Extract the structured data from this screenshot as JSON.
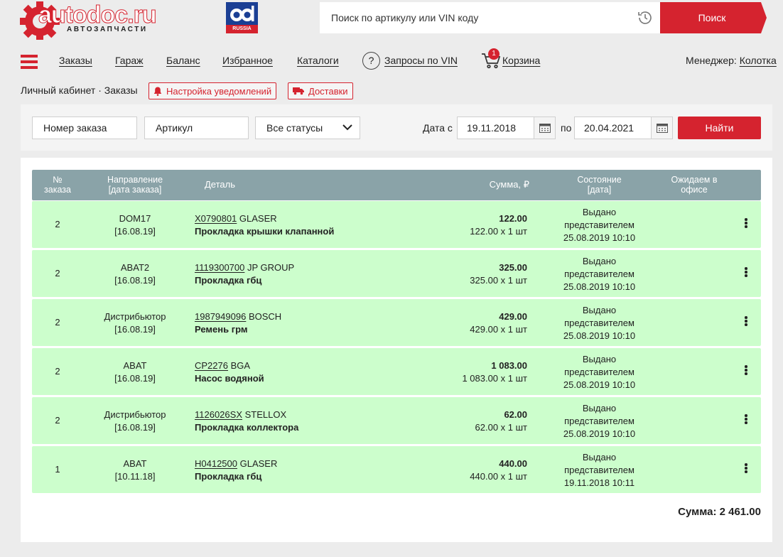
{
  "header": {
    "logo_main": "autodoc.ru",
    "logo_sub": "АВТОЗАПЧАСТИ",
    "partner_logo_text": "RUSSIA",
    "search_placeholder": "Поиск по артикулу или VIN коду",
    "search_button": "Поиск"
  },
  "nav": {
    "orders": "Заказы",
    "garage": "Гараж",
    "balance": "Баланс",
    "favorites": "Избранное",
    "catalogs": "Каталоги",
    "vin_icon": "?",
    "vin_requests": "Запросы по VIN",
    "cart_count": "1",
    "cart": "Корзина",
    "manager_label": "Менеджер:",
    "manager_name": "Колотка"
  },
  "breadcrumb": {
    "text": "Личный кабинет · Заказы",
    "notify_label": "Настройка уведомлений",
    "delivery_label": "Доставки"
  },
  "filters": {
    "order_number": "Номер заказа",
    "article": "Артикул",
    "status": "Все статусы",
    "date_from_label": "Дата с",
    "date_from": "19.11.2018",
    "date_to_label": "по",
    "date_to": "20.04.2021",
    "find_button": "Найти"
  },
  "table": {
    "headers": {
      "num_1": "№",
      "num_2": "заказа",
      "dir_1": "Направление",
      "dir_2": "[дата заказа]",
      "detail": "Деталь",
      "sum": "Сумма, ₽",
      "state_1": "Состояние",
      "state_2": "[дата]",
      "office_1": "Ожидаем в",
      "office_2": "офисе"
    },
    "rows": [
      {
        "num": "2",
        "direction": "DOM17",
        "order_date": "[16.08.19]",
        "article": "X0790801",
        "brand": "GLASER",
        "name": "Прокладка крышки клапанной",
        "total": "122.00",
        "calc": "122.00 х 1 шт",
        "state": "Выдано",
        "state_2": "представителем",
        "state_date": "25.08.2019 10:10"
      },
      {
        "num": "2",
        "direction": "ABAT2",
        "order_date": "[16.08.19]",
        "article": "1119300700",
        "brand": "JP GROUP",
        "name": "Прокладка гбц",
        "total": "325.00",
        "calc": "325.00 х 1 шт",
        "state": "Выдано",
        "state_2": "представителем",
        "state_date": "25.08.2019 10:10"
      },
      {
        "num": "2",
        "direction": "Дистрибьютор",
        "order_date": "[16.08.19]",
        "article": "1987949096",
        "brand": "BOSCH",
        "name": "Ремень грм",
        "total": "429.00",
        "calc": "429.00 х 1 шт",
        "state": "Выдано",
        "state_2": "представителем",
        "state_date": "25.08.2019 10:10"
      },
      {
        "num": "2",
        "direction": "ABAT",
        "order_date": "[16.08.19]",
        "article": "CP2276",
        "brand": "BGA",
        "name": "Насос водяной",
        "total": "1 083.00",
        "calc": "1 083.00 х 1 шт",
        "state": "Выдано",
        "state_2": "представителем",
        "state_date": "25.08.2019 10:10"
      },
      {
        "num": "2",
        "direction": "Дистрибьютор",
        "order_date": "[16.08.19]",
        "article": "1126026SX",
        "brand": "STELLOX",
        "name": "Прокладка коллектора",
        "total": "62.00",
        "calc": "62.00 х 1 шт",
        "state": "Выдано",
        "state_2": "представителем",
        "state_date": "25.08.2019 10:10"
      },
      {
        "num": "1",
        "direction": "ABAT",
        "order_date": "[10.11.18]",
        "article": "H0412500",
        "brand": "GLASER",
        "name": "Прокладка гбц",
        "total": "440.00",
        "calc": "440.00 х 1 шт",
        "state": "Выдано",
        "state_2": "представителем",
        "state_date": "19.11.2018 10:11"
      }
    ],
    "grand_total": "Сумма: 2 461.00"
  },
  "colors": {
    "brand_red": "#d5232f",
    "header_gray": "#8aa3a8",
    "row_green": "#ccfecc"
  },
  "icons": [
    "gear-logo-icon",
    "history-icon",
    "hamburger-menu-icon",
    "question-icon",
    "cart-icon",
    "bell-icon",
    "truck-icon",
    "chevron-down-icon",
    "calendar-icon",
    "kebab-menu-icon"
  ]
}
